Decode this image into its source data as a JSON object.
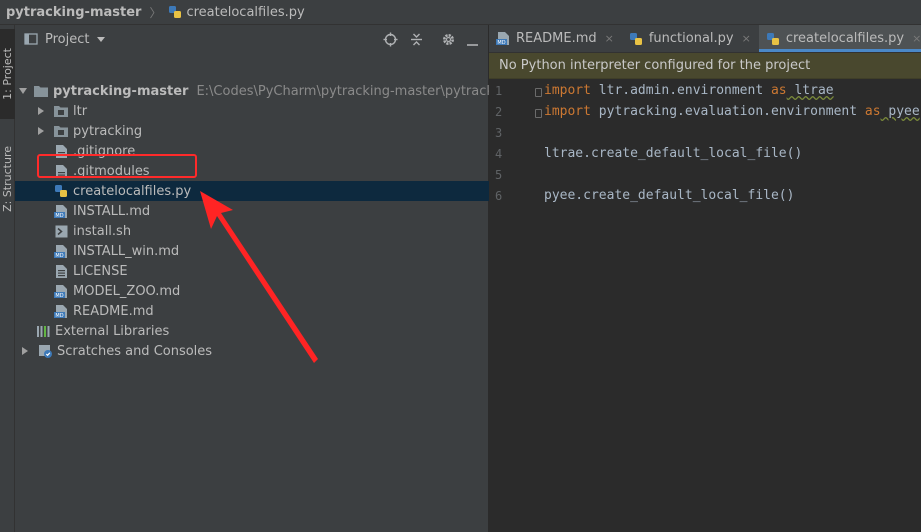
{
  "breadcrumb": {
    "project": "pytracking-master",
    "file": "createlocalfiles.py"
  },
  "tool_strip": {
    "project_tab": "1: Project",
    "structure_tab": "Z: Structure"
  },
  "project_panel": {
    "title": "Project",
    "tree": [
      {
        "label": "pytracking-master",
        "path": "E:\\Codes\\PyCharm\\pytracking-master\\pytracking-mast",
        "type": "folder",
        "expanded": true
      },
      {
        "label": "ltr",
        "type": "folder",
        "expanded": false
      },
      {
        "label": "pytracking",
        "type": "folder",
        "expanded": false
      },
      {
        "label": ".gitignore",
        "type": "text"
      },
      {
        "label": ".gitmodules",
        "type": "text"
      },
      {
        "label": "createlocalfiles.py",
        "type": "python",
        "selected": true
      },
      {
        "label": "INSTALL.md",
        "type": "md"
      },
      {
        "label": "install.sh",
        "type": "sh"
      },
      {
        "label": "INSTALL_win.md",
        "type": "md"
      },
      {
        "label": "LICENSE",
        "type": "text"
      },
      {
        "label": "MODEL_ZOO.md",
        "type": "md"
      },
      {
        "label": "README.md",
        "type": "md"
      },
      {
        "label": "External Libraries",
        "type": "libraries"
      },
      {
        "label": "Scratches and Consoles",
        "type": "scratches",
        "expanded": false
      }
    ]
  },
  "editor": {
    "tabs": [
      {
        "label": "README.md",
        "icon": "markdown-file-icon",
        "active": false
      },
      {
        "label": "functional.py",
        "icon": "python-file-icon",
        "active": false
      },
      {
        "label": "createlocalfiles.py",
        "icon": "python-file-icon",
        "active": true
      }
    ],
    "close_glyph": "×",
    "banner": "No Python interpreter configured for the project",
    "lines": [
      {
        "n": "1",
        "kw1": "import",
        "t1": " ltr.admin.environment ",
        "kw2": "as",
        "t2": " ltrae"
      },
      {
        "n": "2",
        "kw1": "import",
        "t1": " pytracking.evaluation.environment ",
        "kw2": "as",
        "t2": " pyee"
      },
      {
        "n": "3",
        "kw1": "",
        "t1": "",
        "kw2": "",
        "t2": ""
      },
      {
        "n": "4",
        "kw1": "",
        "t1": "ltrae.create_default_local_file()",
        "kw2": "",
        "t2": ""
      },
      {
        "n": "5",
        "kw1": "",
        "t1": "",
        "kw2": "",
        "t2": ""
      },
      {
        "n": "6",
        "kw1": "",
        "t1": "pyee.create_default_local_file()",
        "kw2": "",
        "t2": ""
      }
    ]
  },
  "colors": {
    "accent": "#4a88c7",
    "annotation": "#ff2a2a",
    "keyword": "#cc7832",
    "banner_bg": "#49482e",
    "selection": "#0d293e"
  }
}
